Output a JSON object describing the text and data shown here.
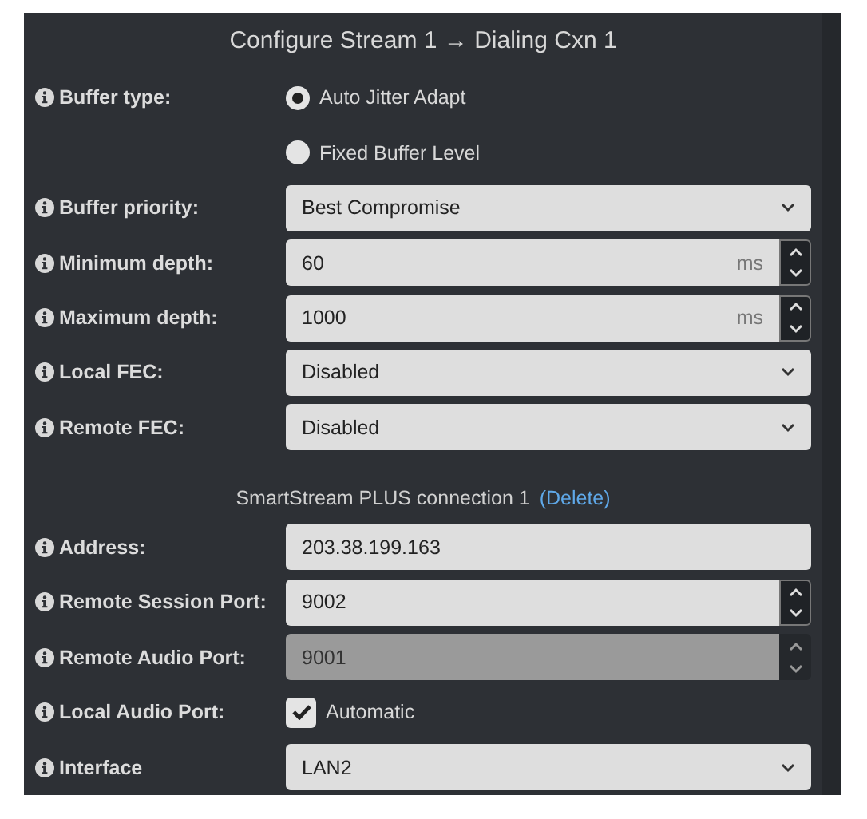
{
  "title": "Configure Stream 1 → Dialing Cxn 1",
  "rows": [
    {
      "kind": "radio",
      "label": "Buffer type:",
      "options": [
        {
          "label": "Auto Jitter Adapt",
          "selected": true
        },
        {
          "label": "Fixed Buffer Level",
          "selected": false
        }
      ]
    },
    {
      "kind": "select",
      "label": "Buffer priority:",
      "value": "Best Compromise"
    },
    {
      "kind": "number",
      "label": "Minimum depth:",
      "value": "60",
      "unit": "ms",
      "disabled": false
    },
    {
      "kind": "number",
      "label": "Maximum depth:",
      "value": "1000",
      "unit": "ms",
      "disabled": false
    },
    {
      "kind": "select",
      "label": "Local FEC:",
      "value": "Disabled"
    },
    {
      "kind": "select",
      "label": "Remote FEC:",
      "value": "Disabled"
    },
    {
      "kind": "heading",
      "text": "SmartStream PLUS connection 1",
      "link": "(Delete)"
    },
    {
      "kind": "text",
      "label": "Address:",
      "value": "203.38.199.163"
    },
    {
      "kind": "number",
      "label": "Remote Session Port:",
      "value": "9002",
      "disabled": false
    },
    {
      "kind": "number",
      "label": "Remote Audio Port:",
      "value": "9001",
      "disabled": true
    },
    {
      "kind": "checkbox",
      "label": "Local Audio Port:",
      "option": "Automatic",
      "checked": true
    },
    {
      "kind": "select",
      "label": "Interface",
      "value": "LAN2"
    }
  ]
}
